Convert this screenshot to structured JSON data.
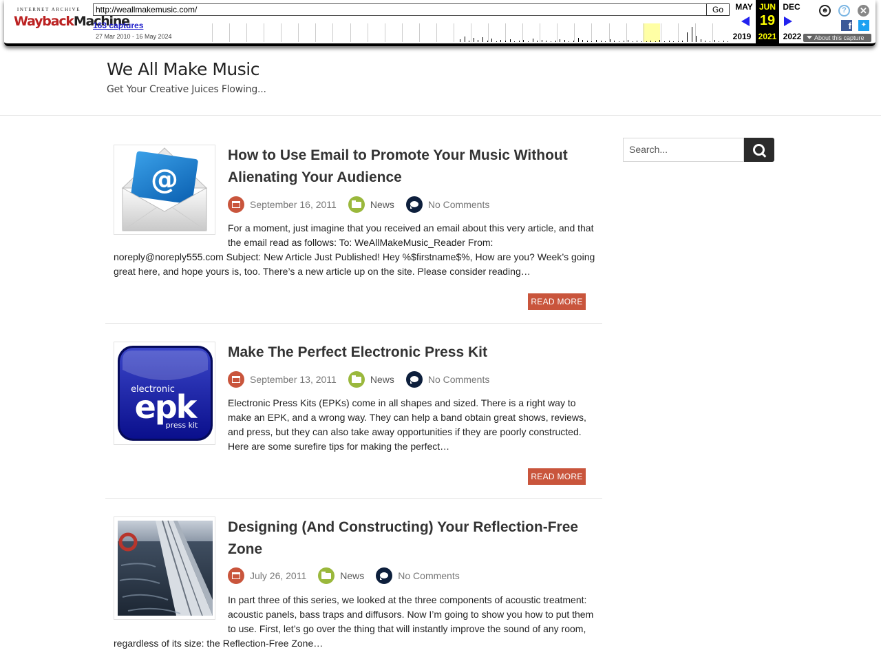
{
  "wayback": {
    "logo_top": "INTERNET ARCHIVE",
    "logo_wayback": "WaybackMachine",
    "url": "http://weallmakemusic.com/",
    "go_label": "Go",
    "captures_label": "163 captures",
    "date_range": "27 Mar 2010 - 16 May 2024",
    "prev_month": "MAY",
    "cur_month": "JUN",
    "next_month": "DEC",
    "cur_day": "19",
    "prev_year": "2019",
    "cur_year": "2021",
    "next_year": "2022",
    "about_label": "About this capture",
    "icons": {
      "user": "user-icon",
      "help": "help-icon",
      "close": "close-icon",
      "facebook": "facebook-icon",
      "twitter": "twitter-icon",
      "prev": "arrow-left-icon",
      "next": "arrow-right-icon"
    },
    "colors": {
      "nav_arrow": "#2222ee",
      "current_bg": "#000000",
      "current_text": "#ffff00",
      "highlight": "#ffffa5"
    }
  },
  "site": {
    "title": "We All Make Music",
    "tagline": "Get Your Creative Juices Flowing..."
  },
  "search": {
    "placeholder": "Search...",
    "button_icon": "search-icon"
  },
  "posts": [
    {
      "title": "How to Use Email to Promote Your Music Without Alienating Your Audience",
      "date": "September 16, 2011",
      "category": "News",
      "comments": "No Comments",
      "excerpt": "For a moment, just imagine that you received an email about this very article, and that the email read as follows: To: WeAllMakeMusic_Reader From: noreply@noreply555.com Subject: New Article Just Published! Hey %$firstname$%, How are you? Week’s going great here, and hope yours is, too. There’s a new article up on the site. Please consider reading…",
      "read_more": "READ MORE",
      "thumb_text": "@"
    },
    {
      "title": "Make The Perfect Electronic Press Kit",
      "date": "September 13, 2011",
      "category": "News",
      "comments": "No Comments",
      "excerpt": "Electronic Press Kits (EPKs) come in all shapes and sized. There is a right way to make an EPK, and a wrong way. They can help a band obtain great shows, reviews, and press, but they can also take away opportunities if they are poorly constructed. Here are some surefire tips for making the perfect…",
      "read_more": "READ MORE",
      "thumb_text": {
        "top": "electronic",
        "main": "epk",
        "bottom": "press kit"
      }
    },
    {
      "title": "Designing (And Constructing) Your Reflection-Free Zone",
      "date": "July 26, 2011",
      "category": "News",
      "comments": "No Comments",
      "excerpt": "In part three of this series, we looked at the three components of acoustic treatment: acoustic panels, bass traps and diffusors. Now I’m going to show you how to put them to use. First, let’s go over the thing that will instantly improve the sound of any room, regardless of its size: the Reflection-Free Zone…"
    }
  ],
  "colors": {
    "accent": "#c9553c",
    "category_icon": "#9ab83c",
    "comment_icon": "#0d1f3c",
    "search_button": "#2b2b2b"
  }
}
